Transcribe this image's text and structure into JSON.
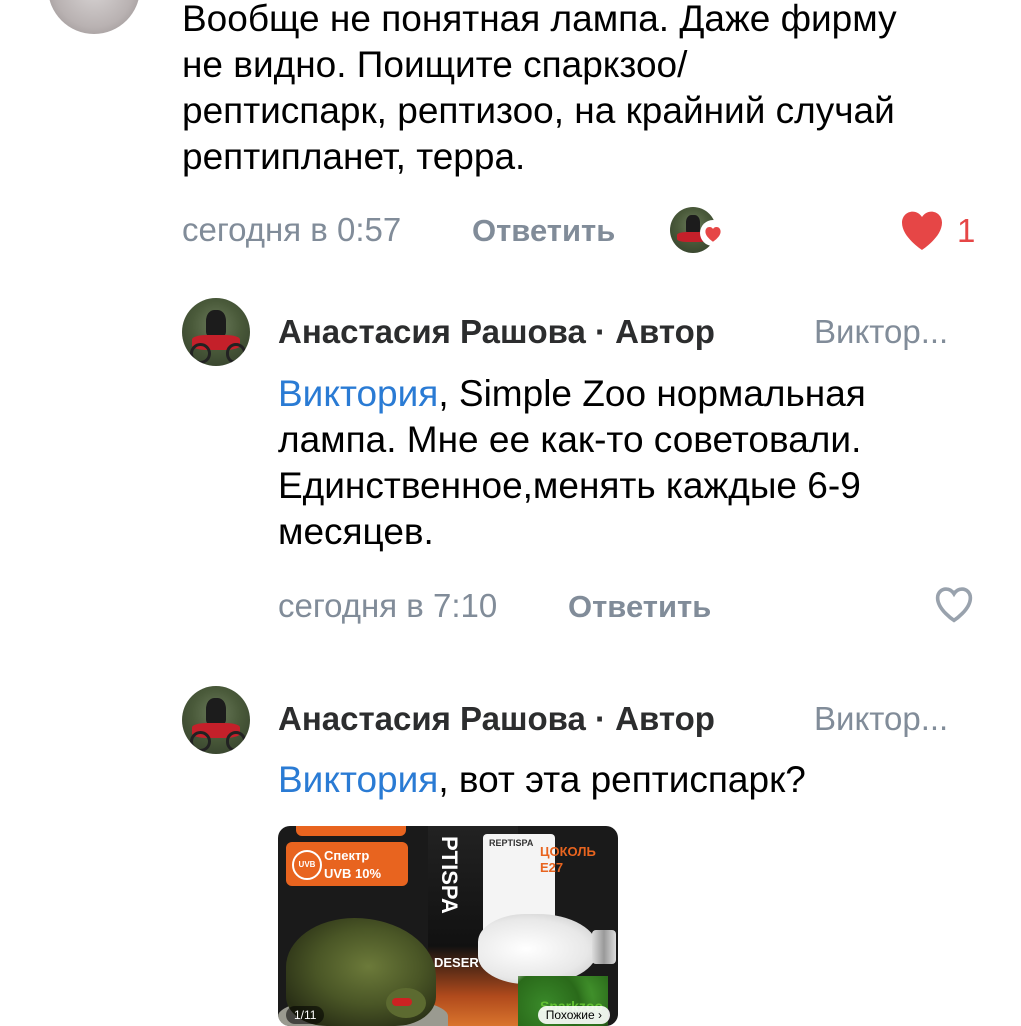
{
  "comment_top": {
    "text": "Вообще не понятная лампа. Даже фирму не видно. Поищите спаркзоо/ рептиспарк, рептизоо, на крайний случай рептипланет, терра.",
    "time": "сегодня в 0:57",
    "reply_label": "Ответить",
    "likes": "1"
  },
  "reply1": {
    "author": "Анастасия Рашова · Автор",
    "reply_to": "Виктор...",
    "mention": "Виктория",
    "text": ", Simple Zoo нормальная лампа. Мне ее как-то советовали. Единственное,менять каждые 6-9 месяцев.",
    "time": "сегодня в 7:10",
    "reply_label": "Ответить"
  },
  "reply2": {
    "author": "Анастасия Рашова · Автор",
    "reply_to": "Виктор...",
    "mention": "Виктория",
    "text": ", вот эта рептиспарк?",
    "image": {
      "badge_line1": "Спектр",
      "badge_line2": "UVB 10%",
      "badge_icon": "UVB",
      "box_brand": "PTISPA",
      "box_sub": "DESERT",
      "pack_text": "REPTISPA",
      "socket_label_1": "ЦОКОЛЬ",
      "socket_label_2": "E27",
      "logo": "Sparkzoo",
      "counter": "1/11",
      "similar": "Похожие ›"
    }
  },
  "colors": {
    "link": "#2a7bd4",
    "meta": "#818c99",
    "like": "#e64646"
  }
}
